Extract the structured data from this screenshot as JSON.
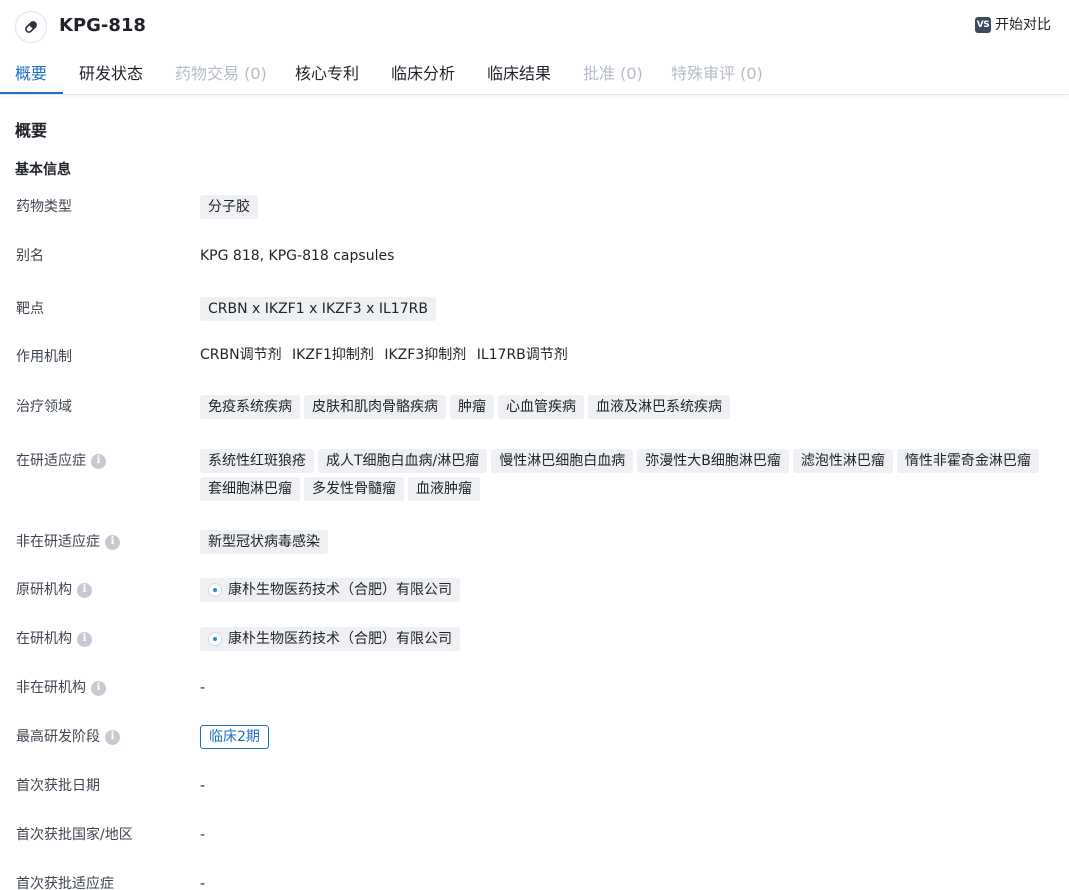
{
  "header": {
    "title": "KPG-818",
    "drug_icon": "pill-icon",
    "compare_badge": "VS",
    "compare_label": "开始对比"
  },
  "tabs": [
    {
      "label": "概要",
      "state": "active"
    },
    {
      "label": "研发状态",
      "state": "normal"
    },
    {
      "label": "药物交易 (0)",
      "state": "disabled"
    },
    {
      "label": "核心专利",
      "state": "normal"
    },
    {
      "label": "临床分析",
      "state": "normal"
    },
    {
      "label": "临床结果",
      "state": "normal"
    },
    {
      "label": "批准 (0)",
      "state": "disabled"
    },
    {
      "label": "特殊审评 (0)",
      "state": "disabled"
    }
  ],
  "section_title": "概要",
  "sub_title": "基本信息",
  "fields": {
    "drug_type": {
      "label": "药物类型",
      "tags": [
        "分子胶"
      ]
    },
    "alias": {
      "label": "别名",
      "value": "KPG 818,  KPG-818 capsules"
    },
    "target": {
      "label": "靶点",
      "tags": [
        "CRBN x IKZF1 x IKZF3 x IL17RB"
      ]
    },
    "mechanism": {
      "label": "作用机制",
      "items": [
        "CRBN调节剂",
        "IKZF1抑制剂",
        "IKZF3抑制剂",
        "IL17RB调节剂"
      ]
    },
    "therapeutic_area": {
      "label": "治疗领域",
      "tags": [
        "免疫系统疾病",
        "皮肤和肌肉骨骼疾病",
        "肿瘤",
        "心血管疾病",
        "血液及淋巴系统疾病"
      ]
    },
    "active_indication": {
      "label": "在研适应症",
      "tags": [
        "系统性红斑狼疮",
        "成人T细胞白血病/淋巴瘤",
        "慢性淋巴细胞白血病",
        "弥漫性大B细胞淋巴瘤",
        "滤泡性淋巴瘤",
        "惰性非霍奇金淋巴瘤",
        "套细胞淋巴瘤",
        "多发性骨髓瘤",
        "血液肿瘤"
      ]
    },
    "inactive_indication": {
      "label": "非在研适应症",
      "tags": [
        "新型冠状病毒感染"
      ]
    },
    "originator": {
      "label": "原研机构",
      "org": "康朴生物医药技术（合肥）有限公司"
    },
    "active_org": {
      "label": "在研机构",
      "org": "康朴生物医药技术（合肥）有限公司"
    },
    "inactive_org": {
      "label": "非在研机构",
      "value": "-"
    },
    "highest_phase": {
      "label": "最高研发阶段",
      "phase": "临床2期"
    },
    "first_approval_date": {
      "label": "首次获批日期",
      "value": "-"
    },
    "first_approval_region": {
      "label": "首次获批国家/地区",
      "value": "-"
    },
    "first_approval_indication": {
      "label": "首次获批适应症",
      "value": "-"
    }
  },
  "colors": {
    "accent": "#1d6fc4",
    "tag_bg": "#eef0f3",
    "disabled_text": "#b6bcc6"
  }
}
